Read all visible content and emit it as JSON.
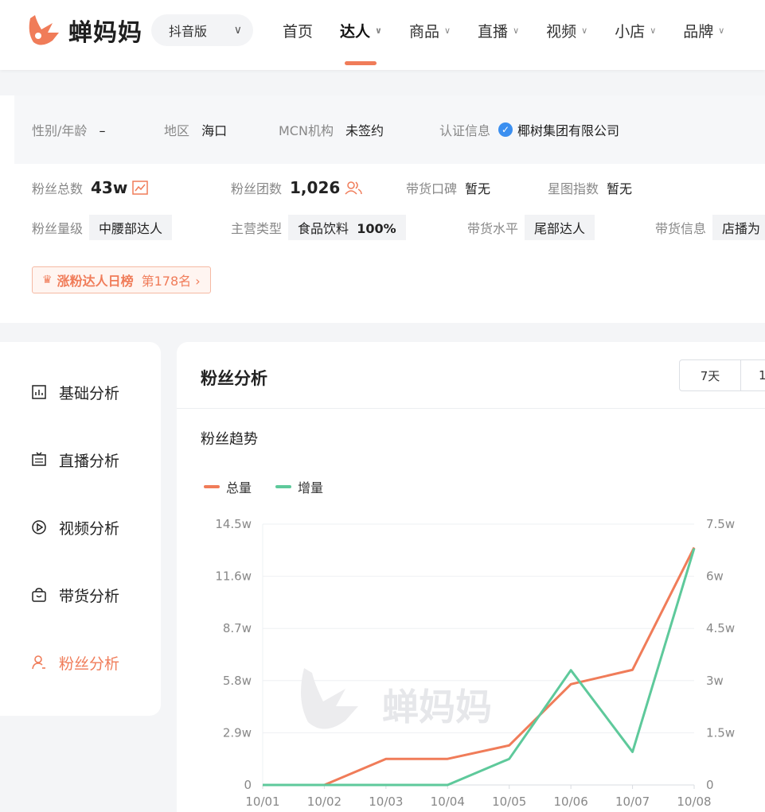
{
  "nav": {
    "logo_text": "蝉妈妈",
    "version": "抖音版",
    "menu": [
      {
        "label": "首页",
        "caret": false,
        "active": false
      },
      {
        "label": "达人",
        "caret": true,
        "active": true
      },
      {
        "label": "商品",
        "caret": true,
        "active": false
      },
      {
        "label": "直播",
        "caret": true,
        "active": false
      },
      {
        "label": "视频",
        "caret": true,
        "active": false
      },
      {
        "label": "小店",
        "caret": true,
        "active": false
      },
      {
        "label": "品牌",
        "caret": true,
        "active": false
      }
    ]
  },
  "profile": {
    "gender_age_label": "性别/年龄",
    "gender_age_value": "–",
    "region_label": "地区",
    "region_value": "海口",
    "mcn_label": "MCN机构",
    "mcn_value": "未签约",
    "cert_label": "认证信息",
    "cert_value": "椰树集团有限公司",
    "fans_total_label": "粉丝总数",
    "fans_total_value": "43w",
    "fans_group_label": "粉丝团数",
    "fans_group_value": "1,026",
    "reputation_label": "带货口碑",
    "reputation_value": "暂无",
    "star_index_label": "星图指数",
    "star_index_value": "暂无",
    "fans_level_label": "粉丝量级",
    "fans_level_value": "中腰部达人",
    "category_label": "主营类型",
    "category_value": "食品饮料",
    "category_pct": "100%",
    "sales_level_label": "带货水平",
    "sales_level_value": "尾部达人",
    "sales_info_label": "带货信息",
    "sales_info_value": "店播为",
    "rank_text": "涨粉达人日榜",
    "rank_num": "第178名 ›"
  },
  "side": {
    "items": [
      {
        "label": "基础分析",
        "icon": "bar-chart-icon",
        "active": false
      },
      {
        "label": "直播分析",
        "icon": "live-icon",
        "active": false
      },
      {
        "label": "视频分析",
        "icon": "play-icon",
        "active": false
      },
      {
        "label": "带货分析",
        "icon": "shopping-bag-icon",
        "active": false
      },
      {
        "label": "粉丝分析",
        "icon": "user-icon",
        "active": true
      }
    ]
  },
  "main": {
    "title": "粉丝分析",
    "ranges": [
      "7天",
      "1"
    ],
    "subtitle": "粉丝趋势",
    "watermark": "蝉妈妈"
  },
  "chart_data": {
    "type": "line",
    "x": [
      "10/01",
      "10/02",
      "10/03",
      "10/04",
      "10/05",
      "10/06",
      "10/07",
      "10/08"
    ],
    "series": [
      {
        "name": "总量",
        "axis": "left",
        "color": "#f07c59",
        "values": [
          0,
          0,
          1.45,
          1.45,
          2.2,
          5.6,
          6.4,
          13.2
        ]
      },
      {
        "name": "增量",
        "axis": "right",
        "color": "#5ec99b",
        "values": [
          0,
          0,
          0,
          0,
          0.75,
          3.3,
          0.95,
          6.8
        ]
      }
    ],
    "y_left": {
      "ticks": [
        "0",
        "2.9w",
        "5.8w",
        "8.7w",
        "11.6w",
        "14.5w"
      ],
      "lim": [
        0,
        14.5
      ]
    },
    "y_right": {
      "ticks": [
        "0",
        "1.5w",
        "3w",
        "4.5w",
        "6w",
        "7.5w"
      ],
      "lim": [
        0,
        7.5
      ]
    },
    "grid": true,
    "legend": "top-left"
  }
}
